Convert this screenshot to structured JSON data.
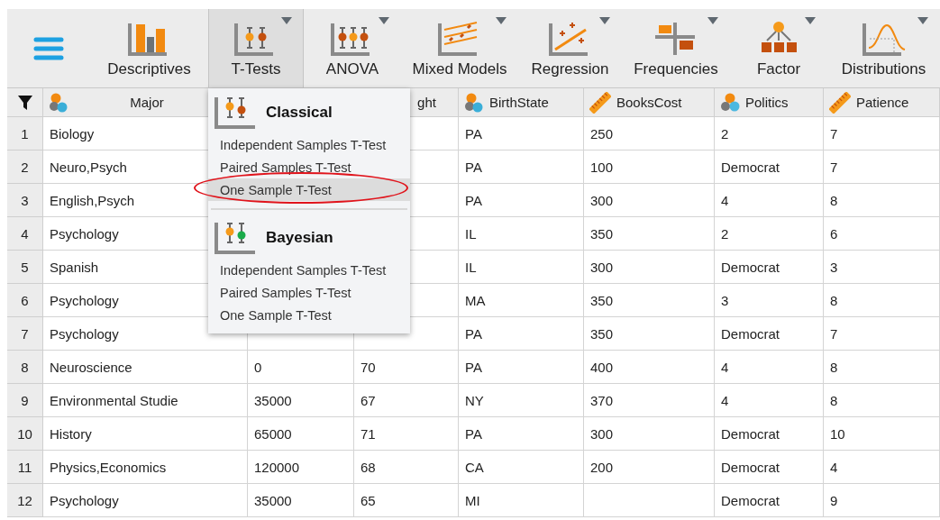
{
  "toolbar": {
    "items": [
      {
        "label": "Descriptives",
        "kind": "bars",
        "menu": false,
        "selected": false
      },
      {
        "label": "T-Tests",
        "kind": "ttest",
        "menu": true,
        "selected": true
      },
      {
        "label": "ANOVA",
        "kind": "anova",
        "menu": true,
        "selected": false
      },
      {
        "label": "Mixed Models",
        "kind": "mixed",
        "menu": true,
        "selected": false
      },
      {
        "label": "Regression",
        "kind": "regression",
        "menu": true,
        "selected": false
      },
      {
        "label": "Frequencies",
        "kind": "frequencies",
        "menu": true,
        "selected": false
      },
      {
        "label": "Factor",
        "kind": "factor",
        "menu": true,
        "selected": false
      },
      {
        "label": "Distributions",
        "kind": "distributions",
        "menu": true,
        "selected": false
      }
    ]
  },
  "table": {
    "columns": [
      {
        "label": "Major",
        "kind": "text"
      },
      {},
      {
        "label": "ght"
      },
      {
        "label": "BirthState",
        "kind": "text"
      },
      {
        "label": "BooksCost",
        "kind": "scale"
      },
      {
        "label": "Politics",
        "kind": "nominal"
      },
      {
        "label": "Patience",
        "kind": "scale"
      }
    ],
    "rows": [
      {
        "number": "1",
        "cells": [
          "Biology",
          null,
          null,
          "PA",
          "250",
          "2",
          "7"
        ]
      },
      {
        "number": "2",
        "cells": [
          "Neuro,Psych",
          null,
          null,
          "PA",
          "100",
          "Democrat",
          "7"
        ]
      },
      {
        "number": "3",
        "cells": [
          "English,Psych",
          null,
          null,
          "PA",
          "300",
          "4",
          "8"
        ]
      },
      {
        "number": "4",
        "cells": [
          "Psychology",
          null,
          null,
          "IL",
          "350",
          "2",
          "6"
        ]
      },
      {
        "number": "5",
        "cells": [
          "Spanish",
          null,
          null,
          "IL",
          "300",
          "Democrat",
          "3"
        ]
      },
      {
        "number": "6",
        "cells": [
          "Psychology",
          null,
          null,
          "MA",
          "350",
          "3",
          "8"
        ]
      },
      {
        "number": "7",
        "cells": [
          "Psychology",
          null,
          null,
          "PA",
          "350",
          "Democrat",
          "7"
        ]
      },
      {
        "number": "8",
        "cells": [
          "Neuroscience",
          "0",
          "70",
          "PA",
          "400",
          "4",
          "8"
        ]
      },
      {
        "number": "9",
        "cells": [
          "Environmental Studie",
          "35000",
          "67",
          "NY",
          "370",
          "4",
          "8"
        ]
      },
      {
        "number": "10",
        "cells": [
          "History",
          "65000",
          "71",
          "PA",
          "300",
          "Democrat",
          "10"
        ]
      },
      {
        "number": "11",
        "cells": [
          "Physics,Economics",
          "120000",
          "68",
          "CA",
          "200",
          "Democrat",
          "4"
        ]
      },
      {
        "number": "12",
        "cells": [
          "Psychology",
          "35000",
          "65",
          "MI",
          null,
          "Democrat",
          "9"
        ]
      }
    ]
  },
  "menu": {
    "sections": [
      {
        "title": "Classical",
        "kind": "classical",
        "items": [
          {
            "label": "Independent Samples T-Test",
            "selected": false,
            "circled": false
          },
          {
            "label": "Paired Samples T-Test",
            "selected": false,
            "circled": false
          },
          {
            "label": "One Sample T-Test",
            "selected": true,
            "circled": true
          }
        ]
      },
      {
        "title": "Bayesian",
        "kind": "bayesian",
        "items": [
          {
            "label": "Independent Samples T-Test",
            "selected": false,
            "circled": false
          },
          {
            "label": "Paired Samples T-Test",
            "selected": false,
            "circled": false
          },
          {
            "label": "One Sample T-Test",
            "selected": false,
            "circled": false
          }
        ]
      }
    ]
  }
}
